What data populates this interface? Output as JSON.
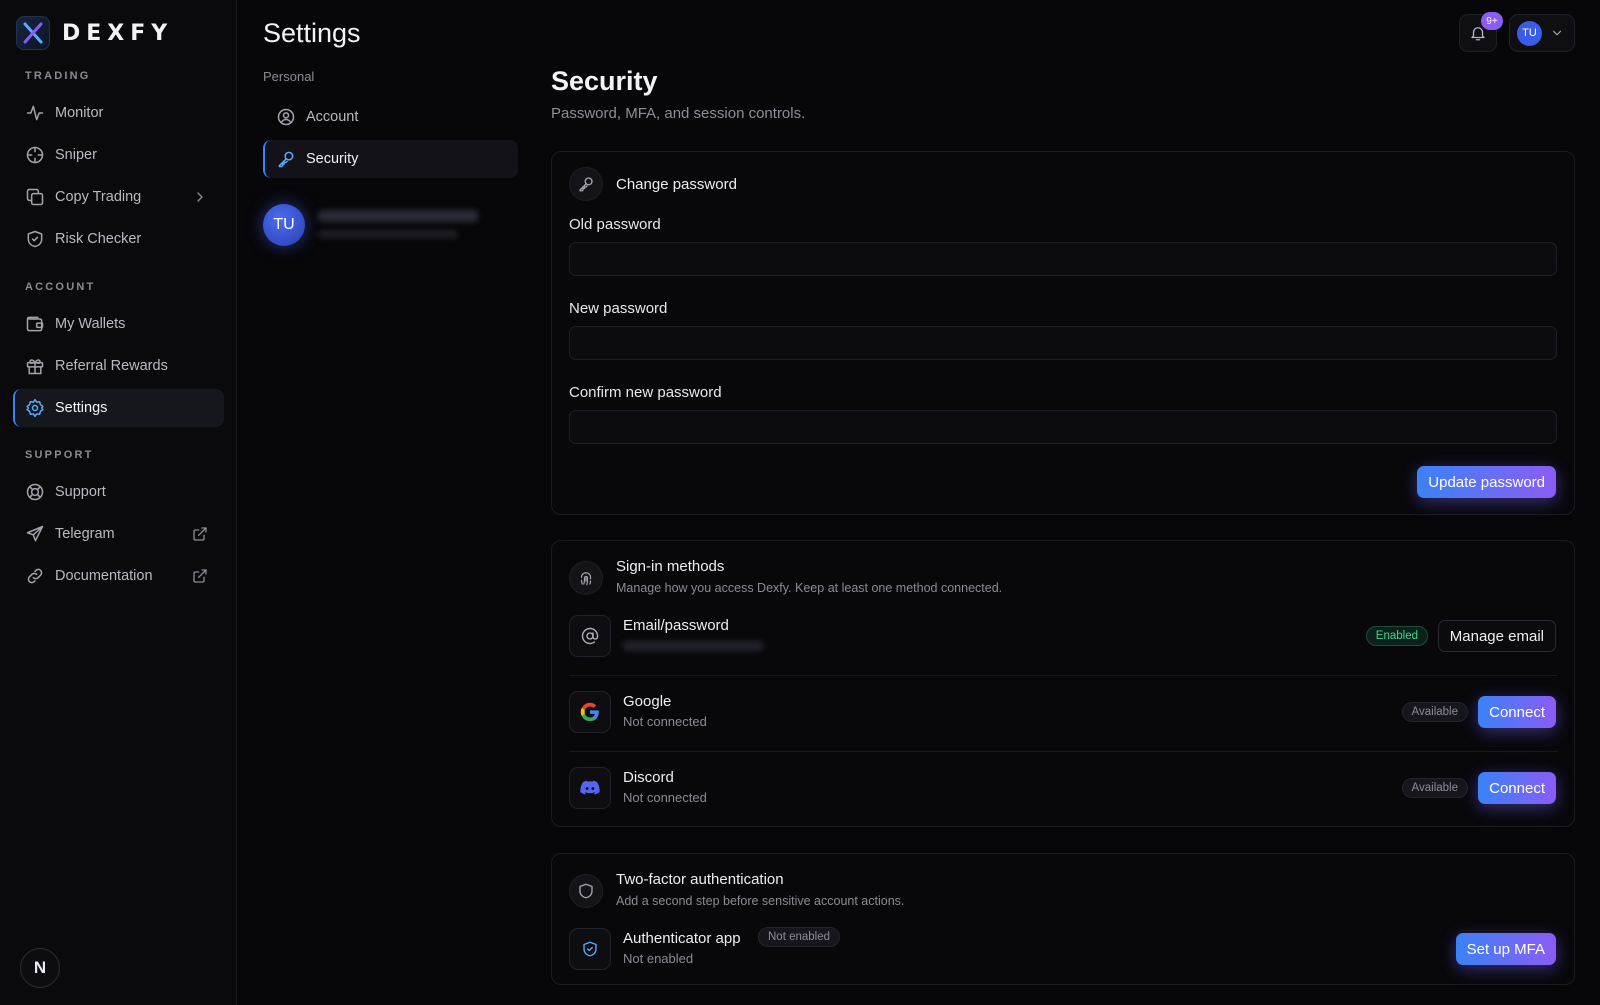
{
  "brand": {
    "name": "DEXFY"
  },
  "sidebar": {
    "sections": {
      "trading": "TRADING",
      "account": "ACCOUNT",
      "support": "SUPPORT"
    },
    "items": [
      {
        "label": "Monitor",
        "icon": "activity-icon"
      },
      {
        "label": "Sniper",
        "icon": "crosshair-icon"
      },
      {
        "label": "Copy Trading",
        "icon": "copy-icon",
        "trail": "chevron-right-icon"
      },
      {
        "label": "Risk Checker",
        "icon": "shield-check-icon"
      },
      {
        "label": "My Wallets",
        "icon": "wallet-icon"
      },
      {
        "label": "Referral Rewards",
        "icon": "gift-icon"
      },
      {
        "label": "Settings",
        "icon": "gear-icon",
        "active": true
      },
      {
        "label": "Support",
        "icon": "lifebuoy-icon"
      },
      {
        "label": "Telegram",
        "icon": "send-icon",
        "trail": "external-link-icon"
      },
      {
        "label": "Documentation",
        "icon": "link-icon",
        "trail": "external-link-icon"
      }
    ],
    "footer_badge": "N"
  },
  "settings_nav": {
    "title": "Settings",
    "section": "Personal",
    "items": [
      {
        "label": "Account",
        "icon": "user-circle-icon"
      },
      {
        "label": "Security",
        "icon": "key-icon",
        "active": true
      }
    ],
    "profile_initials": "TU"
  },
  "topbar": {
    "notification_count": "9+",
    "user_initials": "TU"
  },
  "page": {
    "title": "Security",
    "subtitle": "Password, MFA, and session controls."
  },
  "change_password": {
    "title": "Change password",
    "old_label": "Old password",
    "new_label": "New password",
    "confirm_label": "Confirm new password",
    "submit_label": "Update password"
  },
  "sign_in": {
    "title": "Sign-in methods",
    "desc": "Manage how you access Dexfy. Keep at least one method connected.",
    "methods": [
      {
        "name": "Email/password",
        "status": "Enabled",
        "action": "Manage email"
      },
      {
        "name": "Google",
        "sub": "Not connected",
        "status": "Available",
        "action": "Connect"
      },
      {
        "name": "Discord",
        "sub": "Not connected",
        "status": "Available",
        "action": "Connect"
      }
    ]
  },
  "mfa": {
    "title": "Two-factor authentication",
    "desc": "Add a second step before sensitive account actions.",
    "method_name": "Authenticator app",
    "badge": "Not enabled",
    "sub": "Not enabled",
    "action": "Set up MFA"
  },
  "colors": {
    "accent_blue": "#3b82f6",
    "accent_purple": "#8b5cf6",
    "enabled_green": "#3fd494"
  }
}
